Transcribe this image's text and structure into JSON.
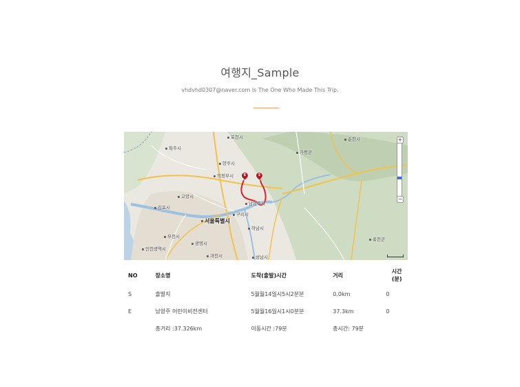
{
  "header": {
    "title": "여행지_Sample",
    "subtitle": "vhdvhd0307@naver.com Is The One Who Made This Trip."
  },
  "map": {
    "labels": [
      {
        "text": "포천시"
      },
      {
        "text": "춘천시"
      },
      {
        "text": "파주시"
      },
      {
        "text": "양주시"
      },
      {
        "text": "의정부시"
      },
      {
        "text": "가평군"
      },
      {
        "text": "고양시"
      },
      {
        "text": "남양주시"
      },
      {
        "text": "김포시"
      },
      {
        "text": "서울특별시",
        "big": true
      },
      {
        "text": "구리시"
      },
      {
        "text": "하남시"
      },
      {
        "text": "부천시"
      },
      {
        "text": "광명시"
      },
      {
        "text": "인천광역시"
      },
      {
        "text": "과천시"
      },
      {
        "text": "성남시"
      },
      {
        "text": "홍천군"
      }
    ],
    "markers": [
      {
        "letter": "E"
      },
      {
        "letter": "S"
      }
    ],
    "zoom_in": "+",
    "zoom_out": "−",
    "route_color": "#d9202a"
  },
  "table": {
    "headers": {
      "no": "NO",
      "name": "장소명",
      "time": "도착(출발)시간",
      "distance": "거리",
      "minutes_line1": "시간",
      "minutes_line2": "(분)"
    },
    "rows": [
      {
        "no": "S",
        "name": "출발지",
        "time": "5월월14일시5시2분분",
        "distance": "0.0km",
        "minutes": "0",
        "link": false
      },
      {
        "no": "E",
        "name": "남양주 어린이비전센터",
        "time": "5월월16일시1시0분분",
        "distance": "37.3km",
        "minutes": "0",
        "link": true
      }
    ],
    "summary": {
      "total_distance": "총거리 :37.326km",
      "travel_time": "이동시간 :79분",
      "total_time": "총시간: 79분"
    }
  }
}
